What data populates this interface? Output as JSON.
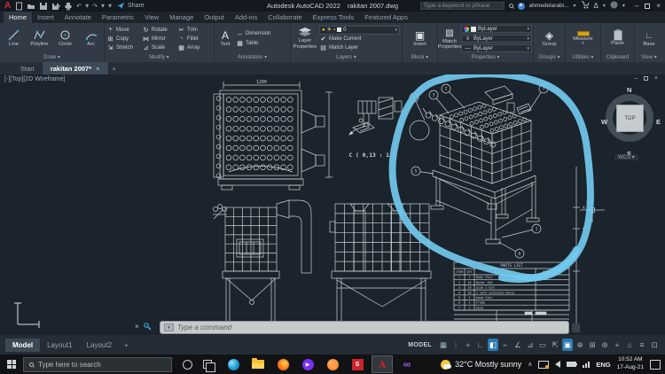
{
  "titlebar": {
    "logo": "A",
    "share": "Share",
    "app_title": "Autodesk AutoCAD 2022",
    "doc_title": "rakitan 2007.dwg",
    "search_placeholder": "Type a keyword or phrase",
    "user": "ahmedelarabi...",
    "autodesk_glyph": "Δ",
    "minimize": "–",
    "close": "×"
  },
  "ribbon": {
    "tabs": [
      "Home",
      "Insert",
      "Annotate",
      "Parametric",
      "View",
      "Manage",
      "Output",
      "Add-ins",
      "Collaborate",
      "Express Tools",
      "Featured Apps"
    ],
    "active_tab": "Home",
    "draw": {
      "label": "Draw",
      "tools": [
        "Line",
        "Polyline",
        "Circle",
        "Arc"
      ]
    },
    "modify": {
      "label": "Modify",
      "tools": [
        {
          "g": "+",
          "label": "Move"
        },
        {
          "g": "⊞",
          "label": "Copy"
        },
        {
          "g": "⇲",
          "label": "Stretch"
        },
        {
          "g": "↻",
          "label": "Rotate"
        },
        {
          "g": "⋈",
          "label": "Mirror"
        },
        {
          "g": "⊿",
          "label": "Scale"
        },
        {
          "g": "✂",
          "label": "Trim"
        },
        {
          "g": "◝",
          "label": "Fillet"
        },
        {
          "g": "▦",
          "label": "Array"
        }
      ]
    },
    "annotation": {
      "label": "Annotation",
      "text_tool": "Text",
      "dimension": "Dimension",
      "table": "Table"
    },
    "layers": {
      "label": "Layers",
      "big": "Layer Properties",
      "layer_value": "0",
      "make_current": "Make Current",
      "match_layer": "Match Layer"
    },
    "block": {
      "label": "Block",
      "big": "Insert"
    },
    "properties": {
      "label": "Properties",
      "big": "Match Properties",
      "rows": [
        "ByLayer",
        "ByLayer",
        "ByLayer"
      ]
    },
    "groups": {
      "label": "Groups",
      "big": "Group"
    },
    "utilities": {
      "label": "Utilities",
      "big": "Measure"
    },
    "clipboard": {
      "label": "Clipboard",
      "big": "Paste"
    },
    "view": {
      "label": "View",
      "big": "Base"
    }
  },
  "file_tabs": {
    "start": "Start",
    "doc": "rakitan 2007*",
    "close": "×",
    "add": "+"
  },
  "viewport_label": "[-][Top][2D Wireframe]",
  "viewcube": {
    "n": "N",
    "s": "S",
    "e": "E",
    "w": "W",
    "face": "TOP",
    "wcs": "WCS"
  },
  "canvas": {
    "line_color": "#c9d2d6",
    "highlight_color": "#71c9ee",
    "dim_top": "1200",
    "detail_label": "C ( 0,13 : 1 )",
    "balloons": [
      "4",
      "3",
      "2",
      "7",
      "5",
      "1",
      "6"
    ],
    "frame_marks": [
      "A",
      "C"
    ],
    "parts_list": {
      "title": "PARTS LIST",
      "columns": [
        "ITEM",
        "QTY",
        "PART NUMBER",
        "DESCRIPTION"
      ],
      "rows": [
        [
          "1",
          "1",
          "Body 25x2",
          ""
        ],
        [
          "2",
          "45",
          "Bytar 150",
          ""
        ],
        [
          "3",
          "10",
          "pipa 1 dim",
          ""
        ],
        [
          "4",
          "10",
          "1 inch solenoid valve",
          ""
        ],
        [
          "5",
          "1",
          "boom 5inc",
          ""
        ],
        [
          "6",
          "1",
          "Frame",
          ""
        ],
        [
          "7",
          "2",
          "hood",
          ""
        ]
      ]
    }
  },
  "command_line": {
    "prompt": "Type a command"
  },
  "layout_tabs": {
    "items": [
      "Model",
      "Layout1",
      "Layout2"
    ],
    "active": "Model",
    "add": "+"
  },
  "status_bar": {
    "model": "MODEL",
    "icons": [
      {
        "g": "▦",
        "on": false
      },
      {
        "g": "⋮",
        "on": false
      },
      {
        "g": "+",
        "on": false
      },
      {
        "g": "∟",
        "on": false
      },
      {
        "g": "◧",
        "on": true
      },
      {
        "g": "⌐",
        "on": false
      },
      {
        "g": "∠",
        "on": false
      },
      {
        "g": "⊿",
        "on": false
      },
      {
        "g": "▭",
        "on": false
      },
      {
        "g": "⇱",
        "on": false
      },
      {
        "g": "▣",
        "on": true
      },
      {
        "g": "⊕",
        "on": false
      },
      {
        "g": "⊞",
        "on": false
      },
      {
        "g": "⊛",
        "on": false
      },
      {
        "g": "+",
        "on": false
      },
      {
        "g": "⌂",
        "on": false
      },
      {
        "g": "≡",
        "on": false
      },
      {
        "g": "⊡",
        "on": false
      }
    ]
  },
  "taskbar": {
    "search_placeholder": "Type here to search",
    "apps": [
      {
        "name": "edge",
        "active": false
      },
      {
        "name": "explorer",
        "active": false
      },
      {
        "name": "firefox",
        "active": false
      },
      {
        "name": "media",
        "active": false
      },
      {
        "name": "cloud",
        "active": false
      },
      {
        "name": "store",
        "active": false
      },
      {
        "name": "autocad",
        "active": true
      },
      {
        "name": "visual-studio",
        "active": false
      }
    ],
    "weather": "32°C Mostly sunny",
    "language": "ENG",
    "time": "10:52 AM",
    "date": "17-Aug-21"
  }
}
